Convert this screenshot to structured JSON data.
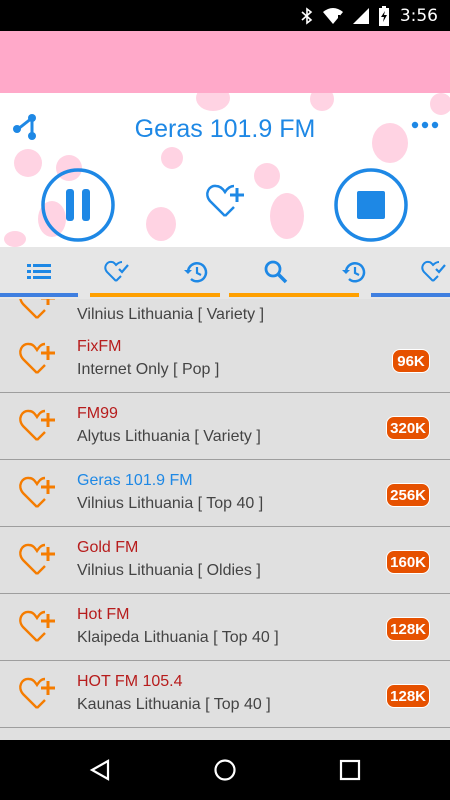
{
  "status_bar": {
    "time": "3:56",
    "icons": [
      "bluetooth-icon",
      "wifi-icon",
      "signal-icon",
      "battery-icon"
    ]
  },
  "player": {
    "title": "Geras 101.9 FM",
    "controls": [
      "share-icon",
      "pause-icon",
      "heart-plus-icon",
      "stop-icon",
      "more-icon"
    ]
  },
  "tabs": [
    {
      "name": "list-icon",
      "active": true
    },
    {
      "name": "favorites-icon"
    },
    {
      "name": "history-icon"
    },
    {
      "name": "search-icon"
    },
    {
      "name": "recent-icon"
    },
    {
      "name": "favorites-icon"
    }
  ],
  "stations": [
    {
      "name": "",
      "location": "Vilnius Lithuania [ Variety ]",
      "bitrate": ""
    },
    {
      "name": "FixFM",
      "location": "Internet Only [ Pop ]",
      "bitrate": "96K"
    },
    {
      "name": "FM99",
      "location": "Alytus Lithuania [ Variety ]",
      "bitrate": "320K"
    },
    {
      "name": "Geras 101.9 FM",
      "location": "Vilnius Lithuania [ Top 40 ]",
      "bitrate": "256K",
      "playing": true
    },
    {
      "name": "Gold FM",
      "location": "Vilnius Lithuania [ Oldies ]",
      "bitrate": "160K"
    },
    {
      "name": "Hot FM",
      "location": "Klaipeda Lithuania [ Top 40 ]",
      "bitrate": "128K"
    },
    {
      "name": "HOT FM 105.4",
      "location": "Kaunas Lithuania [ Top 40 ]",
      "bitrate": "128K"
    }
  ],
  "colors": {
    "accent_blue": "#1e88e5",
    "station_name": "#b71c1c",
    "badge": "#e65100",
    "heart": "#f57c00",
    "pink_band": "#ffa9c9",
    "tab_orange": "#ffa000",
    "tab_blue": "#3f7fe0"
  },
  "nav_bar": [
    "back-icon",
    "home-icon",
    "recents-icon"
  ]
}
